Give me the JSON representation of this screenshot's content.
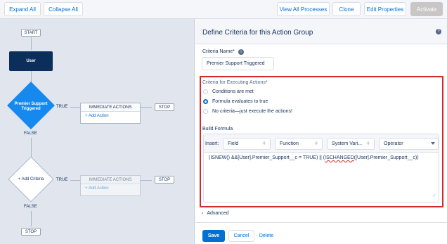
{
  "toolbar": {
    "expand_all": "Expand All",
    "collapse_all": "Collapse All",
    "view_all_processes": "View All Processes",
    "clone": "Clone",
    "edit_properties": "Edit Properties",
    "activate": "Activate"
  },
  "canvas": {
    "start": "START",
    "user_node": "User",
    "criteria1": "Premier Support Triggered",
    "true1": "TRUE",
    "false1": "FALSE",
    "immediate1": "IMMEDIATE ACTIONS",
    "add_action1": "+ Add Action",
    "stop1": "STOP",
    "criteria2": "+ Add Criteria",
    "true2": "TRUE",
    "false2": "FALSE",
    "immediate2": "IMMEDIATE ACTIONS",
    "add_action2": "+ Add Action",
    "stop2": "STOP",
    "stop3": "STOP"
  },
  "panel": {
    "title": "Define Criteria for this Action Group",
    "help_icon": "?",
    "criteria_name_label": "Criteria Name*",
    "info_icon": "i",
    "criteria_name_value": "Premier Support Triggered",
    "criteria_exec_label": "Criteria for Executing Actions*",
    "options": [
      {
        "label": "Conditions are met",
        "selected": false
      },
      {
        "label": "Formula evaluates to true",
        "selected": true
      },
      {
        "label": "No criteria—just execute the actions!",
        "selected": false
      }
    ],
    "build_formula_label": "Build Formula",
    "insert_label": "Insert:",
    "insert_field": "Field",
    "insert_function": "Function",
    "insert_system": "System Vari...",
    "insert_operator": "Operator",
    "formula_part1": "(ISNEW() &&[User].Premier_Support__c = TRUE)  || (",
    "formula_part2": "ISCHANGED",
    "formula_part3": "([User].Premier_Support__c))",
    "advanced": "Advanced",
    "save": "Save",
    "cancel": "Cancel",
    "delete": "Delete"
  },
  "colors": {
    "accent": "#0070d2",
    "user_node": "#0b2f5a",
    "criteria_node": "#1589ee",
    "highlight": "#d32a2a"
  }
}
